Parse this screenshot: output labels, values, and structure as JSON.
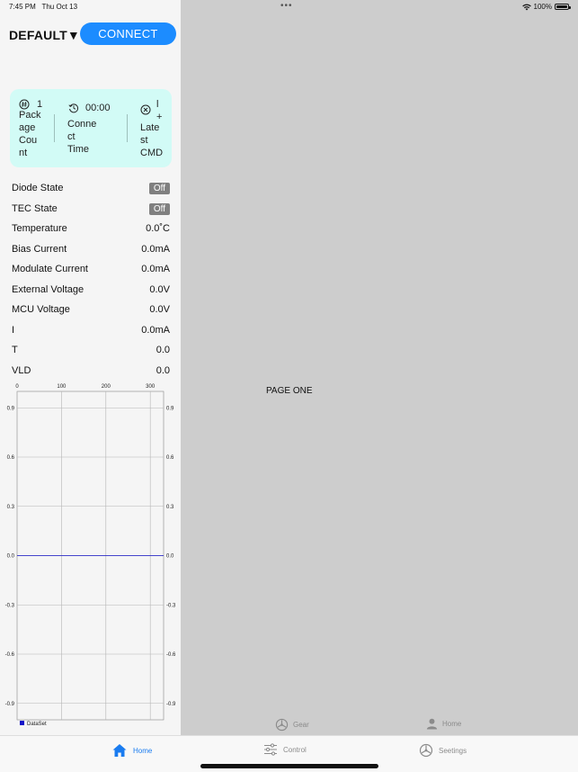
{
  "status_bar": {
    "time": "7:45 PM",
    "date": "Thu Oct 13",
    "battery": "100%"
  },
  "header": {
    "device_label": "DEFAULT▼",
    "connect_label": "CONNECT"
  },
  "summary": {
    "package_count": {
      "value": "1",
      "label_lines": [
        "Pack",
        "age",
        "Cou",
        "nt"
      ],
      "icon": "hash-icon"
    },
    "connect_time": {
      "value": "00:00",
      "label_lines": [
        "Conne",
        "ct",
        "Time"
      ],
      "icon": "history-icon"
    },
    "latest_cmd": {
      "value_lines": [
        "l",
        "+"
      ],
      "label_lines": [
        "Late",
        "st",
        "CMD"
      ],
      "icon": "close-circle-icon"
    }
  },
  "readings": [
    {
      "label": "Diode State",
      "value": "Off",
      "badge": true
    },
    {
      "label": "TEC State",
      "value": "Off",
      "badge": true
    },
    {
      "label": "Temperature",
      "value": "0.0˚C"
    },
    {
      "label": "Bias Current",
      "value": "0.0mA"
    },
    {
      "label": "Modulate Current",
      "value": "0.0mA"
    },
    {
      "label": "External Voltage",
      "value": "0.0V"
    },
    {
      "label": "MCU Voltage",
      "value": "0.0V"
    },
    {
      "label": "I",
      "value": "0.0mA"
    },
    {
      "label": "T",
      "value": "0.0"
    },
    {
      "label": "VLD",
      "value": "0.0"
    }
  ],
  "chart_data": {
    "type": "line",
    "title": "",
    "xlabel": "",
    "ylabel": "",
    "x_ticks": [
      "0",
      "100",
      "200",
      "300"
    ],
    "y_ticks": [
      "0.9",
      "0.6",
      "0.3",
      "0.0",
      "-0.3",
      "-0.6",
      "-0.9"
    ],
    "xlim": [
      0,
      330
    ],
    "ylim": [
      -1.0,
      1.0
    ],
    "grid": true,
    "legend_position": "bottom-left",
    "series": [
      {
        "name": "DataSet",
        "color": "#1414c8",
        "x": [
          0,
          330
        ],
        "y": [
          0.0,
          0.0
        ]
      }
    ]
  },
  "main": {
    "page_label": "PAGE ONE"
  },
  "secondary_tabs": [
    {
      "label": "Gear",
      "icon": "gear-icon"
    },
    {
      "label": "Home",
      "icon": "person-icon"
    }
  ],
  "tabs": [
    {
      "label": "Home",
      "icon": "home-icon",
      "active": true
    },
    {
      "label": "Control",
      "icon": "sliders-icon",
      "active": false
    },
    {
      "label": "Seetings",
      "icon": "settings-icon",
      "active": false
    }
  ],
  "colors": {
    "accent": "#1c8cff",
    "card": "#d2fbf6",
    "active_tab": "#1a7cf0",
    "series": "#1414c8"
  }
}
